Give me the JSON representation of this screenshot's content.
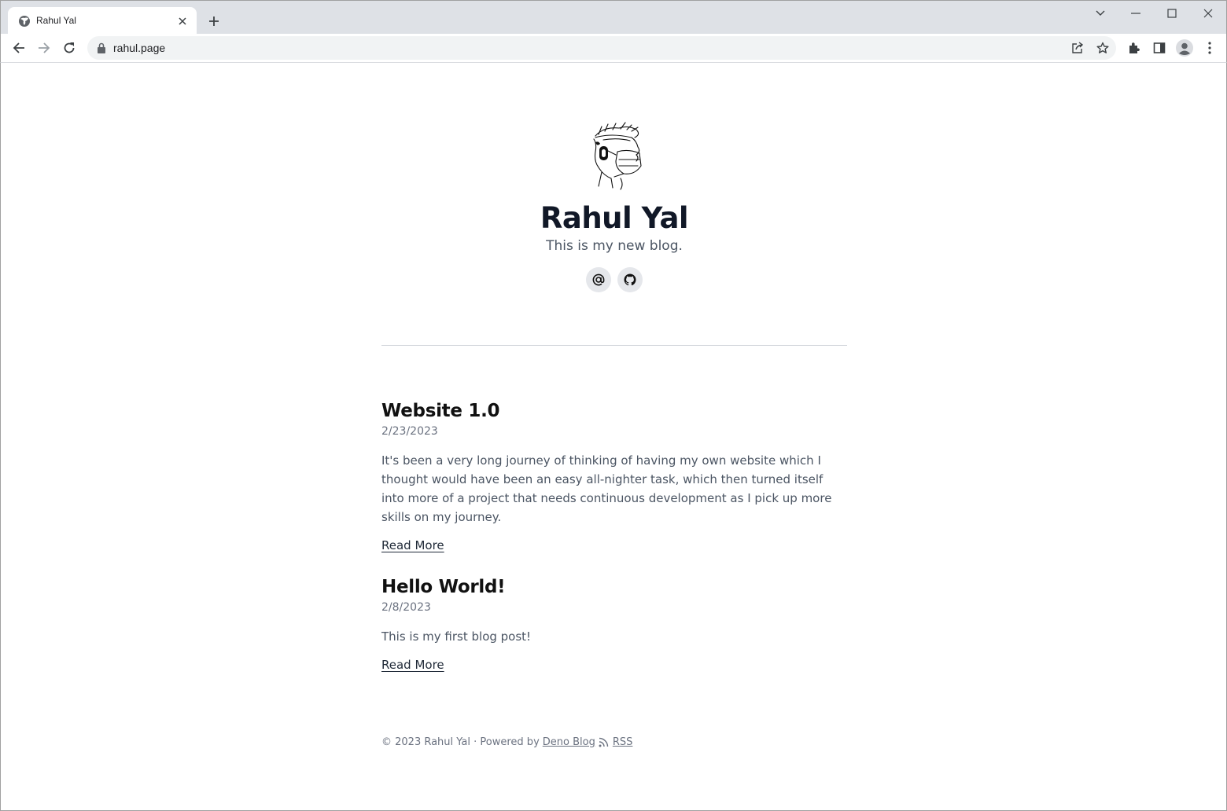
{
  "browser": {
    "tab": {
      "title": "Rahul Yal",
      "favicon": "globe-icon"
    },
    "address_bar": {
      "url": "rahul.page",
      "secure": true
    },
    "toolbar_icons": [
      "back-icon",
      "forward-icon",
      "reload-icon",
      "share-icon",
      "bookmark-star-icon",
      "extensions-icon",
      "side-panel-icon",
      "profile-icon",
      "menu-icon"
    ],
    "window_controls": [
      "tab-search-icon",
      "minimize-icon",
      "maximize-icon",
      "close-icon"
    ]
  },
  "site": {
    "title": "Rahul Yal",
    "description": "This is my new blog.",
    "links": [
      {
        "name": "email",
        "icon": "at-icon"
      },
      {
        "name": "github",
        "icon": "github-icon"
      }
    ]
  },
  "posts": [
    {
      "title": "Website 1.0",
      "date": "2/23/2023",
      "snippet": "It's been a very long journey of thinking of having my own website which I thought would have been an easy all-nighter task, which then turned itself into more of a project that needs continuous development as I pick up more skills on my journey.",
      "link_label": "Read More"
    },
    {
      "title": "Hello World!",
      "date": "2/8/2023",
      "snippet": "This is my first blog post!",
      "link_label": "Read More"
    }
  ],
  "footer": {
    "copyright": "© 2023 Rahul Yal · Powered by",
    "powered_link": "Deno Blog",
    "rss_label": "RSS"
  },
  "colors": {
    "tabstrip": "#dee1e6",
    "omnibox": "#f1f3f4",
    "title": "#111827",
    "muted": "#6b7280",
    "social_bg": "#e5e7eb"
  }
}
